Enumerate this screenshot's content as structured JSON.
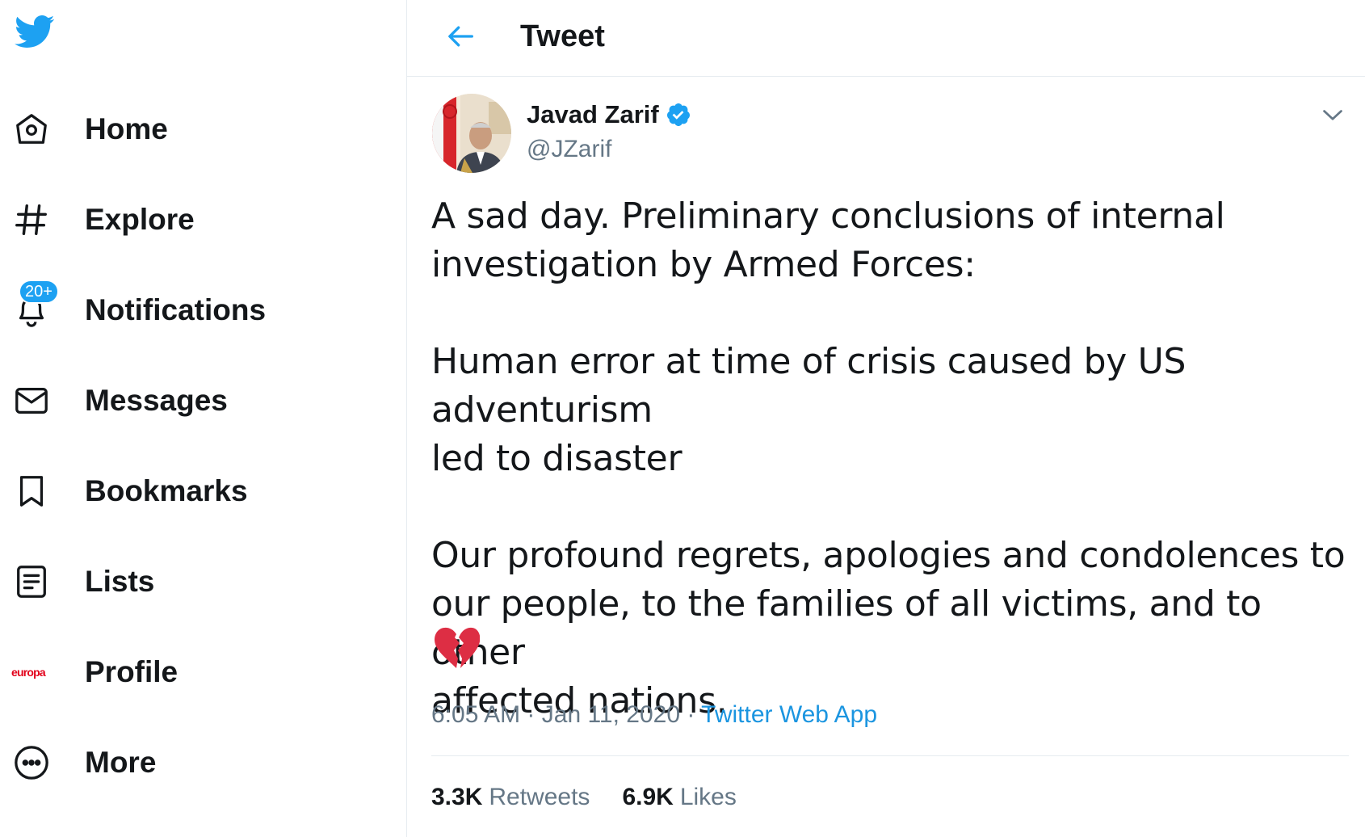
{
  "colors": {
    "accent": "#1da1f2",
    "text": "#14171a",
    "muted": "#657786",
    "link": "#1b95e0",
    "heart": "#e0245e"
  },
  "sidebar": {
    "logo_icon": "twitter-bird-icon",
    "items": [
      {
        "label": "Home",
        "icon": "home-icon"
      },
      {
        "label": "Explore",
        "icon": "hashtag-icon"
      },
      {
        "label": "Notifications",
        "icon": "bell-icon",
        "badge": "20+"
      },
      {
        "label": "Messages",
        "icon": "envelope-icon"
      },
      {
        "label": "Bookmarks",
        "icon": "bookmark-icon"
      },
      {
        "label": "Lists",
        "icon": "list-icon"
      },
      {
        "label": "Profile",
        "icon": "europa-logo-icon",
        "avatar_text": "europa"
      },
      {
        "label": "More",
        "icon": "more-dots-icon"
      }
    ]
  },
  "header": {
    "title": "Tweet",
    "back_icon": "back-arrow-icon"
  },
  "tweet": {
    "author_name": "Javad Zarif",
    "handle": "@JZarif",
    "verified": true,
    "text": "A sad day. Preliminary conclusions of internal\ninvestigation by Armed Forces:\n\nHuman error at time of crisis caused by US adventurism\nled to disaster\n\nOur profound regrets, apologies and condolences to\nour people, to the families of all victims, and to other\naffected nations.",
    "emoji": "broken-heart-icon",
    "time": "6:05 AM",
    "date": "Jan 11, 2020",
    "separator": "·",
    "source": "Twitter Web App",
    "retweets_count": "3.3K",
    "retweets_label": "Retweets",
    "likes_count": "6.9K",
    "likes_label": "Likes"
  }
}
